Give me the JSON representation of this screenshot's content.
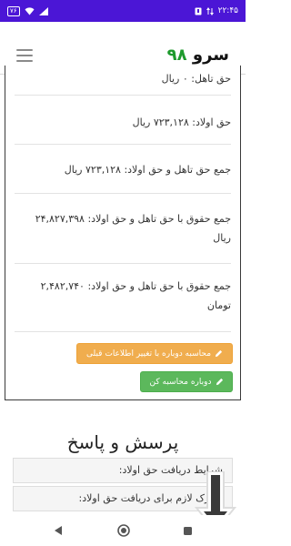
{
  "status_bar": {
    "time": "۲۲:۴۵",
    "battery": "۷۶",
    "icons": [
      "battery-icon",
      "wifi-icon",
      "signal-icon",
      "notification-icon",
      "data-transfer-icon"
    ]
  },
  "header": {
    "title_text": "سرو",
    "title_number": "۹۸",
    "menu_icon": "hamburger-icon"
  },
  "results": [
    {
      "label": "حق تاهل: ۰ ریال"
    },
    {
      "label": "حق اولاد: ۷۲۳,۱۲۸ ریال"
    },
    {
      "label": "جمع حق تاهل و حق اولاد: ۷۲۳,۱۲۸ ریال"
    },
    {
      "label": "جمع حقوق با حق تاهل و حق اولاد: ۲۴,۸۲۷,۳۹۸",
      "label2": "ریال"
    },
    {
      "label": "جمع حقوق با حق تاهل و حق اولاد: ۲,۴۸۲,۷۴۰",
      "label2": "تومان"
    }
  ],
  "buttons": {
    "recalculate_with_previous": "محاسبه دوباره با تغییر اطلاعات قبلی",
    "recalculate": "دوباره محاسبه کن",
    "icon": "pencil-icon"
  },
  "qa": {
    "title": "پرسش و پاسخ",
    "items": [
      "شرایط دریافت حق اولاد:",
      "مدارک لازم برای دریافت حق اولاد:"
    ]
  },
  "colors": {
    "status_bar": "#4b16d6",
    "title_accent": "#1e9a2d",
    "warning": "#f0ad4e",
    "success": "#5cb85c"
  }
}
